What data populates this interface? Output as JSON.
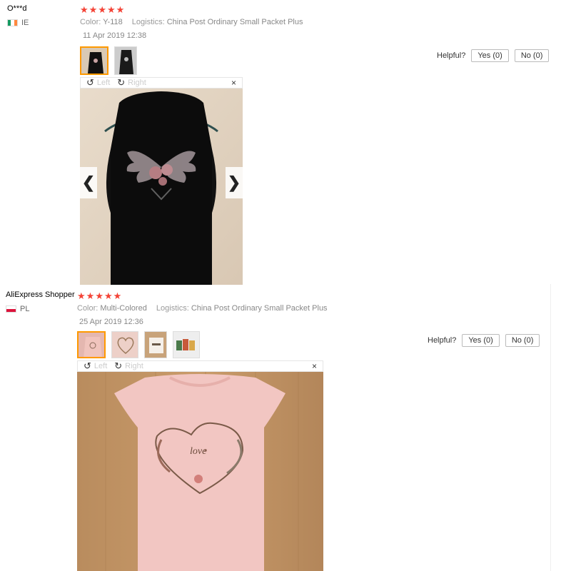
{
  "reviews": [
    {
      "name": "O***d",
      "country": "IE",
      "color_label": "Color:",
      "color_value": "Y-118",
      "logistics_label": "Logistics:",
      "logistics_value": "China Post Ordinary Small Packet Plus",
      "date": "11 Apr 2019 12:38",
      "stars": 5,
      "helpful_label": "Helpful?",
      "yes_label": "Yes (0)",
      "no_label": "No (0)",
      "rotate_left": "Left",
      "rotate_right": "Right",
      "close": "×",
      "prev_arrow": "❮",
      "next_arrow": "❯"
    },
    {
      "name": "AliExpress Shopper",
      "country": "PL",
      "color_label": "Color:",
      "color_value": "Multi-Colored",
      "logistics_label": "Logistics:",
      "logistics_value": "China Post Ordinary Small Packet Plus",
      "date": "25 Apr 2019 12:36",
      "stars": 5,
      "helpful_label": "Helpful?",
      "yes_label": "Yes (0)",
      "no_label": "No (0)",
      "rotate_left": "Left",
      "rotate_right": "Right",
      "close": "×"
    }
  ],
  "colors": {
    "star": "#f44336",
    "thumb_active": "#ff9900"
  },
  "icons": {
    "rotate_left": "rotate-left-icon",
    "rotate_right": "rotate-right-icon",
    "close": "close-icon"
  }
}
